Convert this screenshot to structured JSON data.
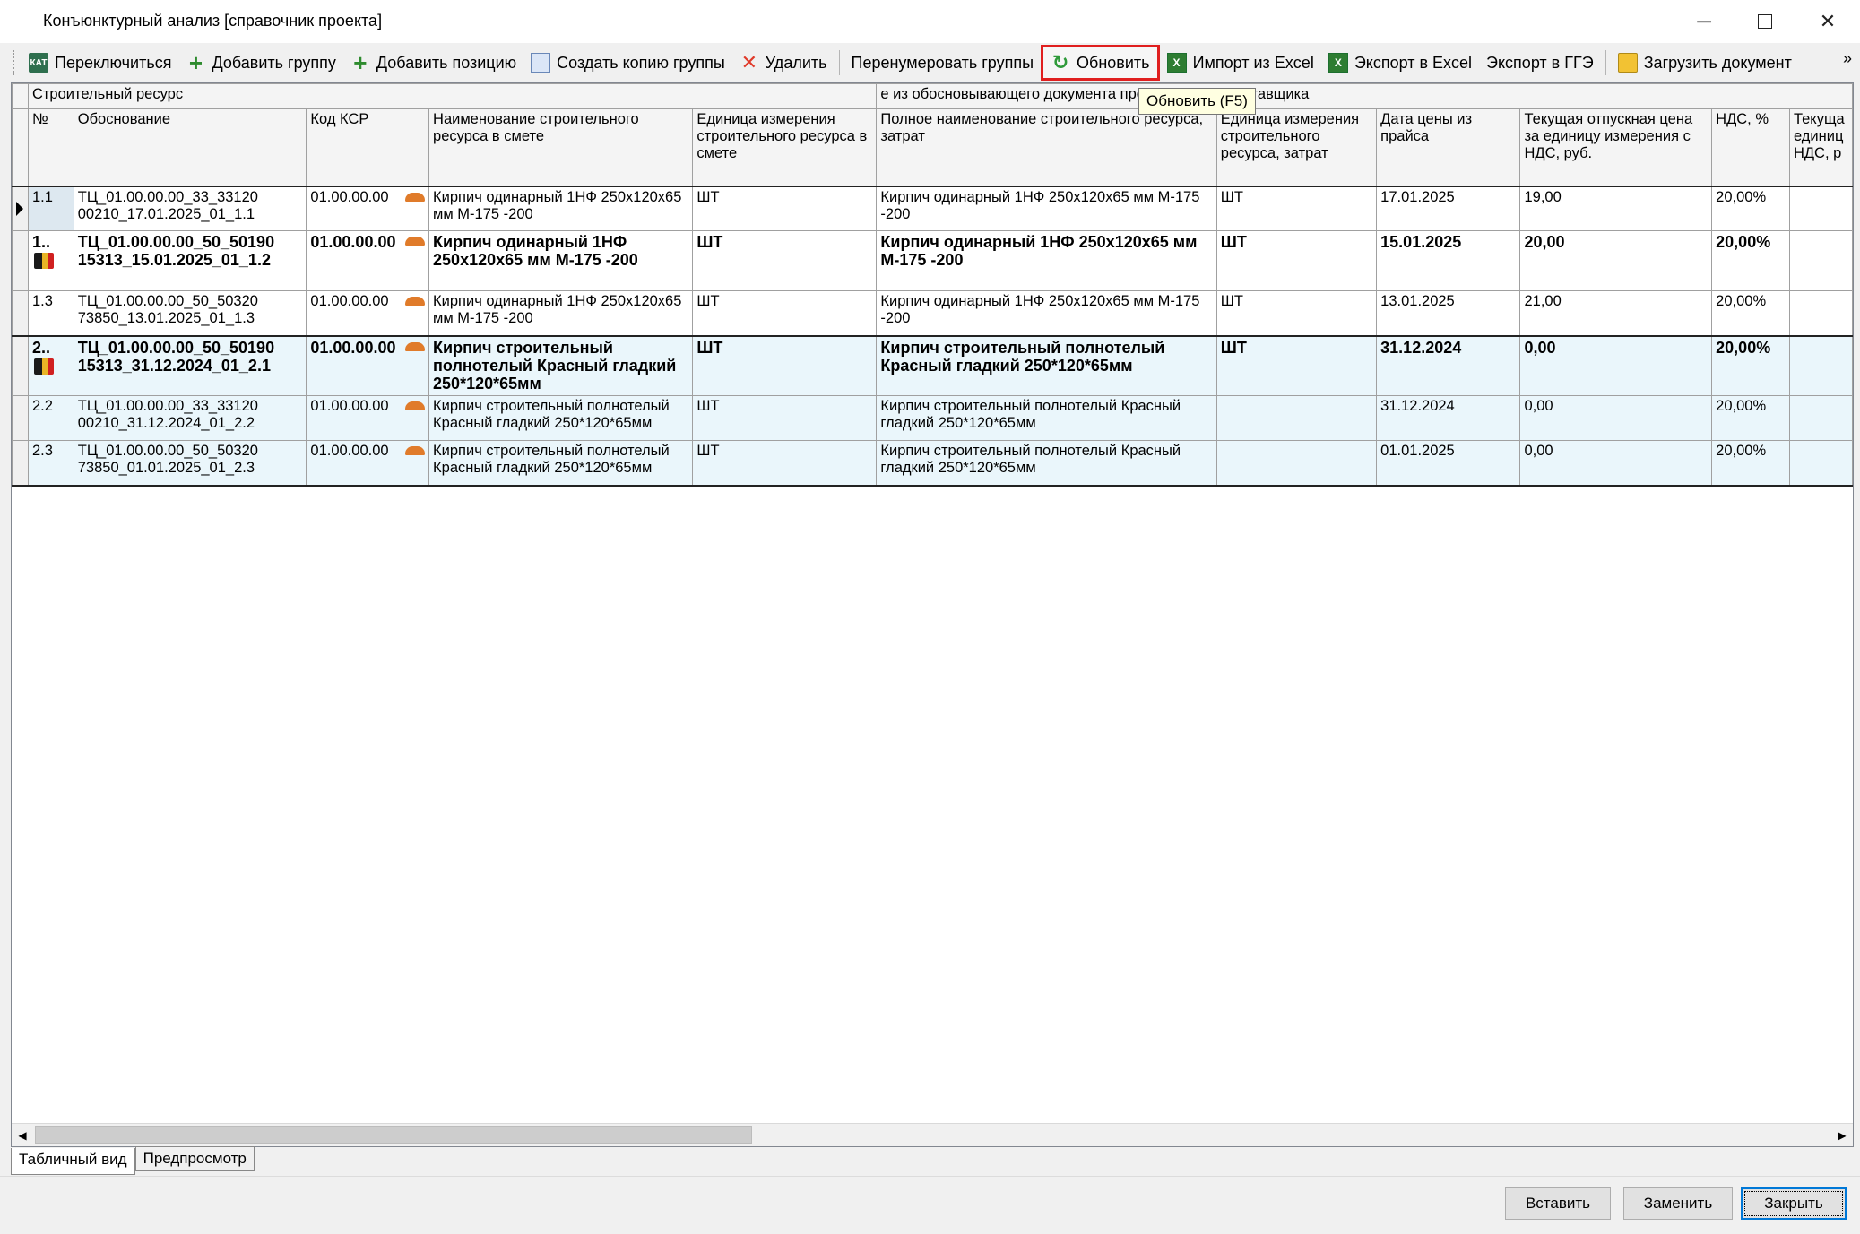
{
  "window": {
    "title": "Конъюнктурный анализ [справочник проекта]",
    "minimize": "─",
    "close": "✕"
  },
  "toolbar": {
    "switch": "Переключиться",
    "add_group": "Добавить группу",
    "add_position": "Добавить позицию",
    "copy_group": "Создать копию группы",
    "delete": "Удалить",
    "renumber": "Перенумеровать группы",
    "refresh": "Обновить",
    "import_excel": "Импорт из Excel",
    "export_excel": "Экспорт в Excel",
    "export_gge": "Экспорт в ГГЭ",
    "load_doc": "Загрузить документ",
    "more": "»",
    "kat_icon_text": "КАТ",
    "excel_icon_text": "X"
  },
  "tooltip": "Обновить (F5)",
  "grid": {
    "band_left": "Строительный ресурс",
    "band_right": "е из обосновывающего документа производителя/поставщика",
    "columns": {
      "num": "№",
      "basis": "Обоснование",
      "ksr": "Код КСР",
      "name": "Наименование строительного ресурса в смете",
      "unit": "Единица измерения строительного ресурса в смете",
      "full_name": "Полное наименование строительного ресурса, затрат",
      "unit2": "Единица измерения строительного ресурса, затрат",
      "price_date": "Дата цены из прайса",
      "price": "Текущая отпускная цена за единицу измерения с НДС, руб.",
      "vat": "НДС, %",
      "cut": "Текуща единиц НДС, р"
    },
    "rows": [
      {
        "num": "1.1",
        "basis": "ТЦ_01.00.00.00_33_33120 00210_17.01.2025_01_1.1",
        "ksr": "01.00.00.00",
        "name": "Кирпич одинарный 1НФ 250х120х65 мм М-175 -200",
        "unit": "ШТ",
        "full_name": "Кирпич одинарный 1НФ 250х120х65 мм М-175 -200",
        "unit2": "ШТ",
        "price_date": "17.01.2025",
        "price": "19,00",
        "vat": "20,00%"
      },
      {
        "num": "1..",
        "basis": "ТЦ_01.00.00.00_50_50190 15313_15.01.2025_01_1.2",
        "ksr": "01.00.00.00",
        "name": "Кирпич одинарный 1НФ 250х120х65 мм М-175 -200",
        "unit": "ШТ",
        "full_name": "Кирпич одинарный 1НФ 250х120х65 мм М-175 -200",
        "unit2": "ШТ",
        "price_date": "15.01.2025",
        "price": "20,00",
        "vat": "20,00%"
      },
      {
        "num": "1.3",
        "basis": "ТЦ_01.00.00.00_50_50320 73850_13.01.2025_01_1.3",
        "ksr": "01.00.00.00",
        "name": "Кирпич одинарный 1НФ 250х120х65 мм М-175 -200",
        "unit": "ШТ",
        "full_name": "Кирпич одинарный 1НФ 250х120х65 мм М-175 -200",
        "unit2": "ШТ",
        "price_date": "13.01.2025",
        "price": "21,00",
        "vat": "20,00%"
      },
      {
        "num": "2..",
        "basis": "ТЦ_01.00.00.00_50_50190 15313_31.12.2024_01_2.1",
        "ksr": "01.00.00.00",
        "name": "Кирпич строительный полнотелый Красный гладкий 250*120*65мм",
        "unit": "ШТ",
        "full_name": "Кирпич строительный полнотелый Красный гладкий 250*120*65мм",
        "unit2": "ШТ",
        "price_date": "31.12.2024",
        "price": "0,00",
        "vat": "20,00%"
      },
      {
        "num": "2.2",
        "basis": "ТЦ_01.00.00.00_33_33120 00210_31.12.2024_01_2.2",
        "ksr": "01.00.00.00",
        "name": "Кирпич строительный полнотелый Красный гладкий 250*120*65мм",
        "unit": "ШТ",
        "full_name": "Кирпич строительный полнотелый Красный гладкий 250*120*65мм",
        "unit2": "",
        "price_date": "31.12.2024",
        "price": "0,00",
        "vat": "20,00%"
      },
      {
        "num": "2.3",
        "basis": "ТЦ_01.00.00.00_50_50320 73850_01.01.2025_01_2.3",
        "ksr": "01.00.00.00",
        "name": "Кирпич строительный полнотелый Красный гладкий 250*120*65мм",
        "unit": "ШТ",
        "full_name": "Кирпич строительный полнотелый Красный гладкий 250*120*65мм",
        "unit2": "",
        "price_date": "01.01.2025",
        "price": "0,00",
        "vat": "20,00%"
      }
    ]
  },
  "tabs": {
    "table_view": "Табличный вид",
    "preview": "Предпросмотр"
  },
  "buttons": {
    "insert": "Вставить",
    "replace": "Заменить",
    "close": "Закрыть"
  },
  "colors": {
    "highlight": "#e01f1f",
    "group_row_bg": "#eaf6fb",
    "default_button_border": "#0078d7"
  }
}
